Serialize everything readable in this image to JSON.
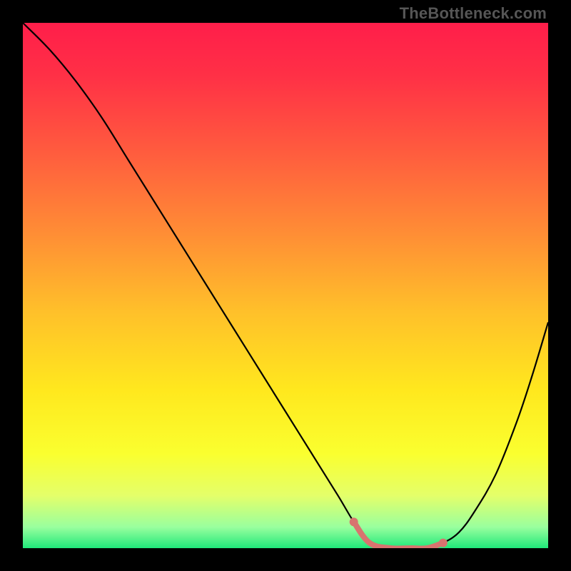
{
  "watermark": "TheBottleneck.com",
  "chart_data": {
    "type": "line",
    "title": "",
    "xlabel": "",
    "ylabel": "",
    "xlim": [
      0,
      100
    ],
    "ylim": [
      0,
      100
    ],
    "series": [
      {
        "name": "bottleneck-curve",
        "x": [
          0,
          5,
          10,
          15,
          20,
          25,
          30,
          35,
          40,
          45,
          50,
          55,
          60,
          63,
          66,
          70,
          74,
          77,
          80,
          83,
          86,
          90,
          94,
          97,
          100
        ],
        "y": [
          100,
          95,
          89,
          82,
          74,
          66,
          58,
          50,
          42,
          34,
          26,
          18,
          10,
          5,
          1,
          0,
          0,
          0,
          1,
          3,
          7,
          14,
          24,
          33,
          43
        ]
      }
    ],
    "highlight_segment": {
      "name": "optimal-range",
      "x": [
        63,
        66,
        70,
        74,
        77,
        80
      ],
      "y": [
        5,
        1,
        0,
        0,
        0,
        1
      ]
    },
    "background_gradient_stops": [
      {
        "pos": 0.0,
        "color": "#ff1e4a"
      },
      {
        "pos": 0.1,
        "color": "#ff3046"
      },
      {
        "pos": 0.25,
        "color": "#ff5d3e"
      },
      {
        "pos": 0.4,
        "color": "#ff8d35"
      },
      {
        "pos": 0.55,
        "color": "#ffc02a"
      },
      {
        "pos": 0.7,
        "color": "#ffe81e"
      },
      {
        "pos": 0.82,
        "color": "#faff2f"
      },
      {
        "pos": 0.9,
        "color": "#e4ff6a"
      },
      {
        "pos": 0.96,
        "color": "#99ff9e"
      },
      {
        "pos": 1.0,
        "color": "#20e87a"
      }
    ],
    "curve_color": "#000000",
    "highlight_color": "#d8736f",
    "highlight_dot_radius": 6,
    "highlight_stroke_width": 8
  }
}
